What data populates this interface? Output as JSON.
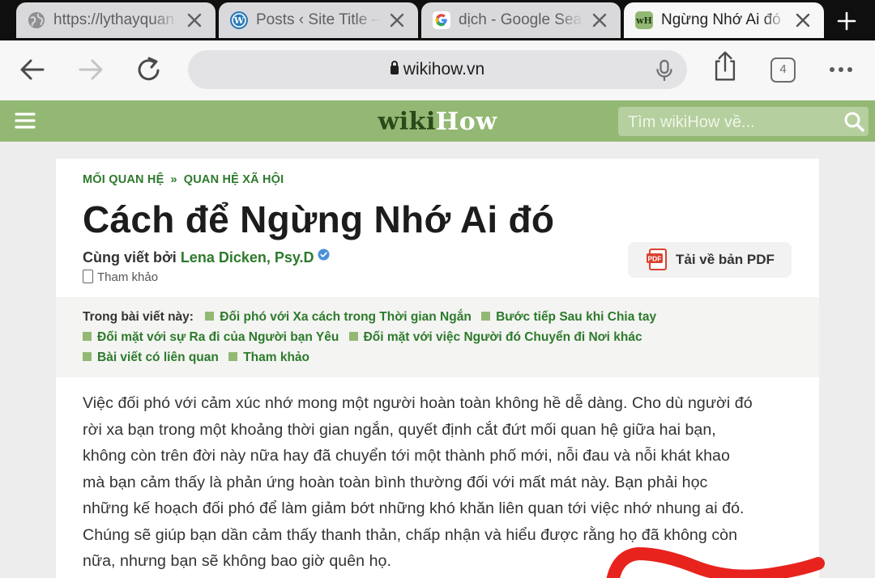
{
  "browser": {
    "tabs": [
      {
        "title": "https://lythayquan.",
        "favicon": "globe-icon"
      },
      {
        "title": "Posts ‹ Site Title —",
        "favicon": "wordpress-icon"
      },
      {
        "title": "dịch - Google Search",
        "favicon": "google-icon"
      },
      {
        "title": "Ngừng Nhớ Ai đó – wikiHow",
        "favicon": "wikihow-icon",
        "favicon_text": "wH",
        "active": true
      }
    ],
    "url": "wikihow.vn",
    "tab_count": "4"
  },
  "site": {
    "logo_part1": "wiki",
    "logo_part2": "How",
    "search_placeholder": "Tìm wikiHow về...",
    "brand_color": "#93b874",
    "link_color": "#2d7a2c"
  },
  "article": {
    "breadcrumb": [
      "MỐI QUAN HỆ",
      "QUAN HỆ XÃ HỘI"
    ],
    "breadcrumb_sep": "»",
    "title": "Cách để Ngừng Nhớ Ai đó",
    "author_prefix": "Cùng viết bởi",
    "author_name": "Lena Dicken, Psy.D",
    "refs_label": "Tham khảo",
    "pdf_button": "Tải về bản PDF",
    "pdf_icon_text": "PDF",
    "toc_label": "Trong bài viết này:",
    "toc_items": [
      "Đối phó với Xa cách trong Thời gian Ngắn",
      "Bước tiếp Sau khi Chia tay",
      "Đối mặt với sự Ra đi của Người bạn Yêu",
      "Đối mặt với việc Người đó Chuyển đi Nơi khác",
      "Bài viết có liên quan",
      "Tham khảo"
    ],
    "intro_lines": [
      "Việc đối phó với cảm xúc nhớ mong một người hoàn toàn không hề dễ dàng. Cho dù người đó",
      "rời xa bạn trong một khoảng thời gian ngắn, quyết định cắt đứt mối quan hệ giữa hai bạn,",
      "không còn trên đời này nữa hay đã chuyển tới một thành phố mới, nỗi đau và nỗi khát khao",
      "mà bạn cảm thấy là phản ứng hoàn toàn bình thường đối với mất mát này. Bạn phải học",
      "những kế hoạch đối phó để làm giảm bớt những khó khăn liên quan tới việc nhớ nhung ai đó.",
      "Chúng sẽ giúp bạn dần cảm thấy thanh thản, chấp nhận và hiểu được rằng họ đã không còn",
      "nữa, nhưng bạn sẽ không bao giờ quên họ."
    ]
  }
}
